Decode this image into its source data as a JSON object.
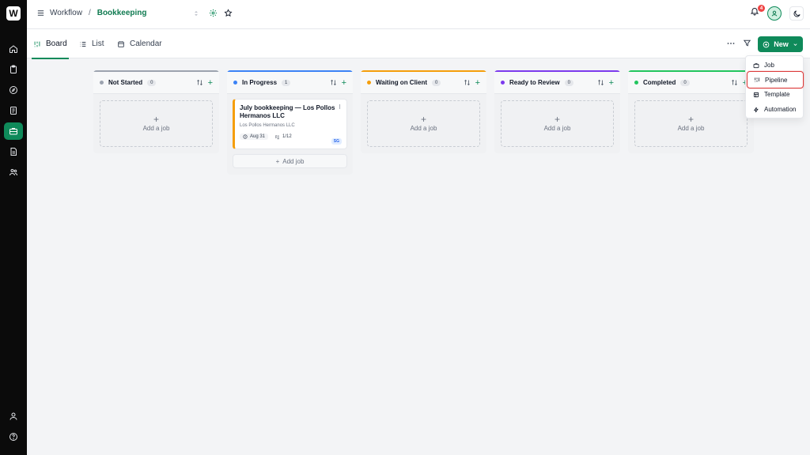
{
  "app": {
    "logo_letter": "W"
  },
  "breadcrumb": {
    "workspace": "Workflow",
    "separator": "/",
    "pipeline": "Bookkeeping"
  },
  "notifications": {
    "count": "4"
  },
  "views": {
    "tabs": [
      {
        "label": "Board"
      },
      {
        "label": "List"
      },
      {
        "label": "Calendar"
      }
    ]
  },
  "new_button": {
    "label": "New"
  },
  "new_menu": {
    "items": [
      {
        "label": "Job"
      },
      {
        "label": "Pipeline"
      },
      {
        "label": "Template"
      },
      {
        "label": "Automation"
      }
    ]
  },
  "columns": [
    {
      "name": "Not Started",
      "count": "0",
      "color": "#9ca3af",
      "add_label": "Add a job"
    },
    {
      "name": "In Progress",
      "count": "1",
      "color": "#3b82f6",
      "add_label": "Add job"
    },
    {
      "name": "Waiting on Client",
      "count": "0",
      "color": "#f59e0b",
      "add_label": "Add a job"
    },
    {
      "name": "Ready to Review",
      "count": "0",
      "color": "#7c3aed",
      "add_label": "Add a job"
    },
    {
      "name": "Completed",
      "count": "0",
      "color": "#22c55e",
      "add_label": "Add a job"
    }
  ],
  "job_card": {
    "title": "July bookkeeping — Los Pollos Hermanos LLC",
    "client": "Los Pollos Hermanos LLC",
    "due": "Aug 31",
    "tasks": "1/12",
    "assignee": "SG",
    "accent": "#f59e0b"
  },
  "colors": {
    "brand": "#0f8a5a",
    "highlight": "#dc3b3b"
  }
}
